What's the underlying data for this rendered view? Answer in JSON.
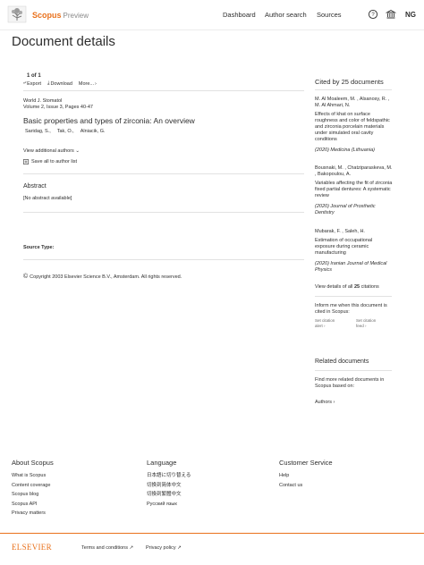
{
  "header": {
    "brand": "Scopus",
    "brand_suffix": "Preview",
    "nav": [
      "Dashboard",
      "Author search",
      "Sources"
    ],
    "avatar_initials": "NG"
  },
  "page_title": "Document details",
  "document": {
    "results": "1 of 1",
    "toolbar": {
      "export": "Export",
      "download": "Download",
      "more": "More..."
    },
    "journal": "World J. Stomatol",
    "volume": "Volume 2, Issue 3, Pages 40-47",
    "title": "Basic properties and types of zirconia: An overview",
    "authors": [
      "Saridag, S.,",
      "Tak, O.,",
      "Alniacik, G."
    ],
    "view_authors": "View additional authors",
    "save_list": "Save all to author list",
    "abstract_heading": "Abstract",
    "abstract_text": "[No abstract available]",
    "source_type": "Source Type:",
    "copyright": "Copyright 2003 Elsevier Science B.V., Amsterdam. All rights reserved."
  },
  "sidebar": {
    "cited_heading": "Cited by 25 documents",
    "citations": [
      {
        "authors": "M. Al Moaleem, M. , Alsanosy, R. , M. Al Ahmari, N.",
        "title": "Effects of khat on surface roughness and color of feldspathic and zirconia porcelain materials under simulated oral cavity conditions",
        "source": "(2020) Medicina (Lithuania)"
      },
      {
        "authors": "Bousnaki, M. , Chatziparaskeva, M. , Bakopoulou, A.",
        "title": "Variables affecting the fit of zirconia fixed partial dentures: A systematic review",
        "source": "(2020) Journal of Prosthetic Dentistry"
      },
      {
        "authors": "Mubarak, F. , Saleh, H.",
        "title": "Estimation of occupational exposure during ceramic manufacturing",
        "source": "(2020) Iranian Journal of Medical Physics"
      }
    ],
    "view_all_prefix": "View details of all",
    "view_all_count": "25",
    "view_all_suffix": "citations",
    "inform_text": "Inform me when this document is cited in Scopus:",
    "alerts": [
      {
        "line1": "Set citation",
        "line2": "alert"
      },
      {
        "line1": "Set citation",
        "line2": "feed"
      }
    ],
    "related_heading": "Related documents",
    "related_text": "Find more related documents in Scopus based on:",
    "related_authors": "Authors"
  },
  "footer": {
    "about": {
      "heading": "About Scopus",
      "links": [
        "What is Scopus",
        "Content coverage",
        "Scopus blog",
        "Scopus API",
        "Privacy matters"
      ]
    },
    "language": {
      "heading": "Language",
      "links": [
        "日本語に切り替える",
        "切换到简体中文",
        "切換到繁體中文",
        "Русский язык"
      ]
    },
    "service": {
      "heading": "Customer Service",
      "links": [
        "Help",
        "Contact us"
      ]
    },
    "elsevier": "ELSEVIER",
    "terms": "Terms and conditions",
    "privacy": "Privacy policy"
  },
  "colors": {
    "accent": "#e9711c",
    "text": "#2e2e2e",
    "divider": "#e2e2e2"
  }
}
